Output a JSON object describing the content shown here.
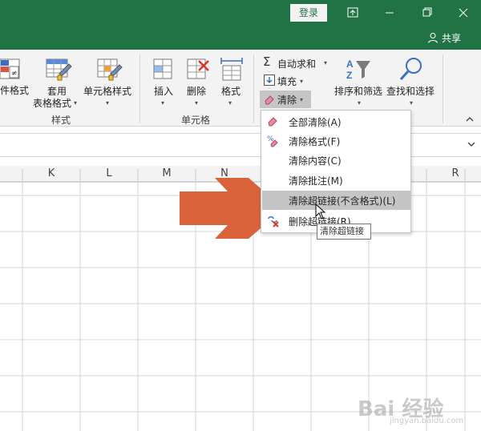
{
  "titlebar": {
    "login_label": "登录",
    "share_label": "共享",
    "controls": [
      "ribbon-display-icon",
      "minimize-icon",
      "restore-icon",
      "close-icon"
    ]
  },
  "ribbon": {
    "styles": {
      "conditional_format_label": "件格式",
      "table_format_label_line1": "套用",
      "table_format_label_line2": "表格格式",
      "cell_styles_label": "单元格样式",
      "group_label": "样式"
    },
    "cells": {
      "insert_label": "插入",
      "delete_label": "删除",
      "format_label": "格式",
      "group_label": "单元格"
    },
    "editing": {
      "autosum_label": "自动求和",
      "fill_label": "填充",
      "clear_label": "清除",
      "sort_filter_label": "排序和筛选",
      "find_select_label": "查找和选择"
    }
  },
  "sheet": {
    "column_headers": [
      "K",
      "L",
      "M",
      "N",
      "R"
    ]
  },
  "clear_menu": {
    "items": [
      {
        "label": "全部清除(A)",
        "icon": "eraser-icon"
      },
      {
        "label": "清除格式(F)",
        "icon": "clear-format-icon"
      },
      {
        "label": "清除内容(C)",
        "icon": ""
      },
      {
        "label": "清除批注(M)",
        "icon": ""
      },
      {
        "label": "清除超链接(不含格式)(L)",
        "icon": "",
        "highlighted": true
      },
      {
        "label": "删除超链接(R)",
        "icon": "remove-hyperlink-icon"
      }
    ]
  },
  "tooltip": {
    "text": "清除超链接"
  },
  "watermark": {
    "text": "Bai 经验",
    "sub": "jingyan.baidu.com"
  },
  "colors": {
    "title_green": "#217346",
    "ribbon_bg": "#f3f3f3",
    "arrow_orange": "#d9623b",
    "highlight_gray": "#c5c5c5"
  }
}
